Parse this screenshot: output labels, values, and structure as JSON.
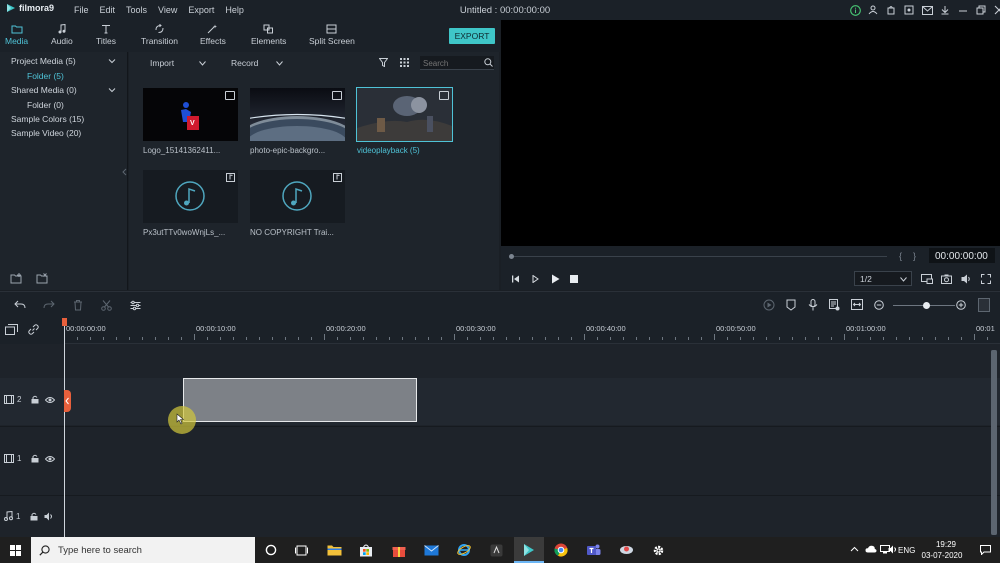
{
  "app": {
    "name": "filmora9",
    "window_title": "Untitled : 00:00:00:00",
    "menu": [
      "File",
      "Edit",
      "Tools",
      "View",
      "Export",
      "Help"
    ]
  },
  "toolbar": {
    "tabs": [
      "Media",
      "Audio",
      "Titles",
      "Transition",
      "Effects",
      "Elements",
      "Split Screen"
    ],
    "export_label": "EXPORT"
  },
  "sidebar": {
    "items": [
      {
        "label": "Project Media (5)"
      },
      {
        "label": "Folder (5)"
      },
      {
        "label": "Shared Media (0)"
      },
      {
        "label": "Folder (0)"
      },
      {
        "label": "Sample Colors (15)"
      },
      {
        "label": "Sample Video (20)"
      }
    ]
  },
  "media_bar": {
    "import_label": "Import",
    "record_label": "Record",
    "search_placeholder": "Search"
  },
  "media_items": [
    {
      "label": "Logo_15141362411...",
      "type": "image"
    },
    {
      "label": "photo-epic-backgro...",
      "type": "image"
    },
    {
      "label": "videoplayback (5)",
      "type": "video"
    },
    {
      "label": "Px3utTTv0woWnjLs_...",
      "type": "audio"
    },
    {
      "label": "NO COPYRIGHT Trai...",
      "type": "audio"
    }
  ],
  "preview": {
    "timecode": "00:00:00:00",
    "quality": "1/2"
  },
  "timeline": {
    "ruler_labels": [
      "00:00:00:00",
      "00:00:10:00",
      "00:00:20:00",
      "00:00:30:00",
      "00:00:40:00",
      "00:00:50:00",
      "00:01:00:00",
      "00:01"
    ],
    "tracks": [
      {
        "label": "2",
        "kind": "video"
      },
      {
        "label": "1",
        "kind": "video"
      },
      {
        "label": "1",
        "kind": "audio"
      }
    ]
  },
  "taskbar": {
    "search_placeholder": "Type here to search",
    "language": "ENG",
    "time": "19:29",
    "date": "03-07-2020"
  },
  "colors": {
    "accent": "#4fc3d7",
    "export_button": "#3fc6c8",
    "playhead": "#e8603c",
    "panel": "#1e242b"
  }
}
